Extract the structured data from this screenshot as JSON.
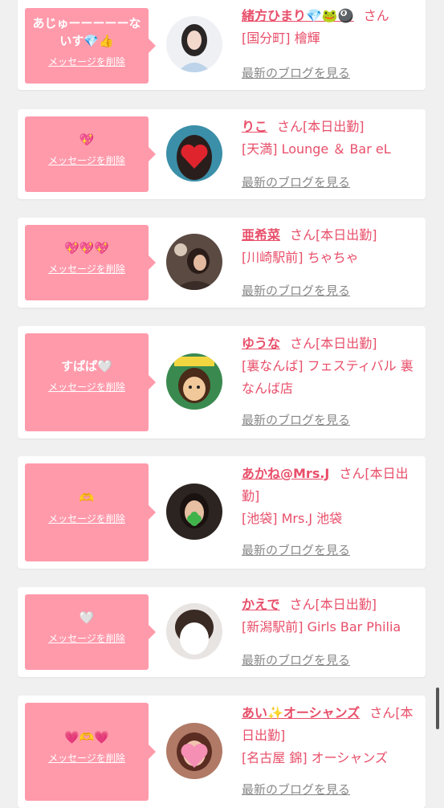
{
  "colors": {
    "accent": "#e84f6a",
    "bubble": "#ff9aab",
    "background": "#f0f0f0"
  },
  "delete_label": "メッセージを削除",
  "blog_label": "最新のブログを見る",
  "items": [
    {
      "message": "あじゅーーーーーないす💎👍",
      "name": "緒方ひまり💎🐸🎱",
      "san": "さん",
      "status": "",
      "shop": "[国分町] 檜輝",
      "avatar_icon": "woman-portrait"
    },
    {
      "message": "💖",
      "name": "りこ",
      "san": "さん",
      "status": "[本日出勤]",
      "shop": "[天満] Lounge ＆ Bar eL",
      "avatar_icon": "heart-cover-portrait"
    },
    {
      "message": "💖💖💖",
      "name": "亜希菜",
      "san": "さん",
      "status": "[本日出勤]",
      "shop": "[川崎駅前] ちゃちゃ",
      "avatar_icon": "woman-portrait"
    },
    {
      "message": "すぱぱ🤍",
      "name": "ゆうな",
      "san": "さん",
      "status": "[本日出勤]",
      "shop": "[裏なんば] フェスティバル 裏なんば店",
      "avatar_icon": "cartoon-girl"
    },
    {
      "message": "🫶",
      "name": "あかね@Mrs.J",
      "san": "さん",
      "status": "[本日出勤]",
      "shop": "[池袋] Mrs.J 池袋",
      "avatar_icon": "clover-cover-portrait"
    },
    {
      "message": "🤍",
      "name": "かえで",
      "san": "さん",
      "status": "[本日出勤]",
      "shop": "[新潟駅前] Girls Bar Philia",
      "avatar_icon": "blurred-portrait"
    },
    {
      "message": "💗🫶💗",
      "name": "あい✨オーシャンズ",
      "san": "さん",
      "status": "[本日出勤]",
      "shop": "[名古屋 錦] オーシャンズ",
      "avatar_icon": "heart-cover-portrait"
    }
  ]
}
